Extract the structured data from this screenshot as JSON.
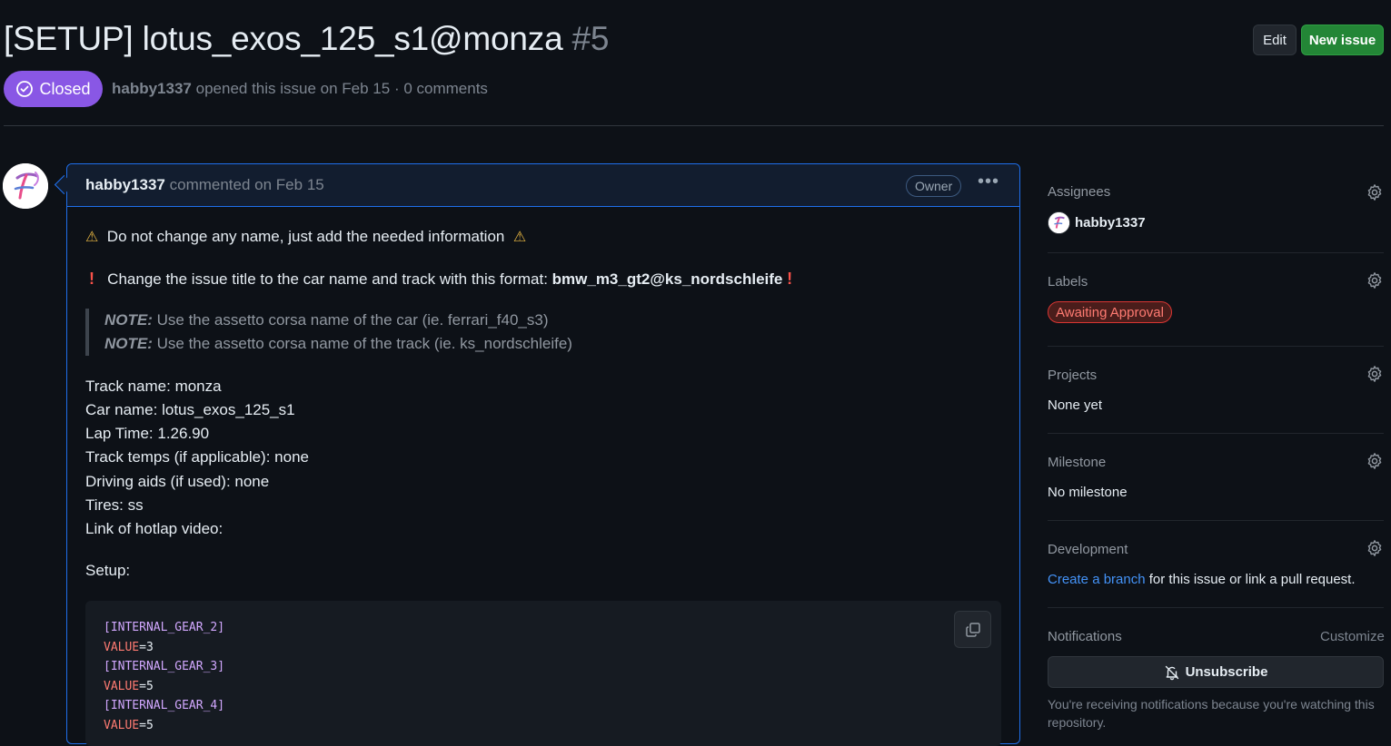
{
  "issue": {
    "title": "[SETUP] lotus_exos_125_s1@monza",
    "number": "#5",
    "state": "Closed",
    "author": "habby1337",
    "meta_text": "opened this issue on Feb 15 · 0 comments"
  },
  "header_actions": {
    "edit": "Edit",
    "new_issue": "New issue"
  },
  "comment": {
    "author": "habby1337",
    "meta": "commented on Feb 15",
    "role_badge": "Owner",
    "menu_icon": "kebab-horizontal-icon",
    "line1": "Do not change any name, just add the needed information",
    "line2_prefix": "Change the issue title to the car name and track with this format: ",
    "line2_bold": "bmw_m3_gt2@ks_nordschleife",
    "note_label": "NOTE:",
    "note1": " Use the assetto corsa name of the car (ie. ferrari_f40_s3)",
    "note2": " Use the assetto corsa name of the track (ie. ks_nordschleife)",
    "fields": [
      "Track name: monza",
      "Car name: lotus_exos_125_s1",
      "Lap Time: 1.26.90",
      "Track temps (if applicable): none",
      "Driving aids (if used): none",
      "Tires: ss",
      "Link of hotlap video:"
    ],
    "setup_label": "Setup:",
    "code": [
      {
        "section": "[INTERNAL_GEAR_2]"
      },
      {
        "key": "VALUE",
        "value": "=3"
      },
      {
        "section": "[INTERNAL_GEAR_3]"
      },
      {
        "key": "VALUE",
        "value": "=5"
      },
      {
        "section": "[INTERNAL_GEAR_4]"
      },
      {
        "key": "VALUE",
        "value": "=5"
      }
    ]
  },
  "sidebar": {
    "assignees": {
      "heading": "Assignees",
      "user": "habby1337"
    },
    "labels": {
      "heading": "Labels",
      "label": "Awaiting Approval",
      "color": "#da3633"
    },
    "projects": {
      "heading": "Projects",
      "value": "None yet"
    },
    "milestone": {
      "heading": "Milestone",
      "value": "No milestone"
    },
    "development": {
      "heading": "Development",
      "link1": "Create a branch",
      "rest": " for this issue or link a pull request."
    },
    "notifications": {
      "heading": "Notifications",
      "customize": "Customize",
      "button": "Unsubscribe",
      "text": "You're receiving notifications because you're watching this repository."
    }
  },
  "colors": {
    "accent": "#1f6feb",
    "closed": "#8957e5",
    "primary": "#238636"
  }
}
